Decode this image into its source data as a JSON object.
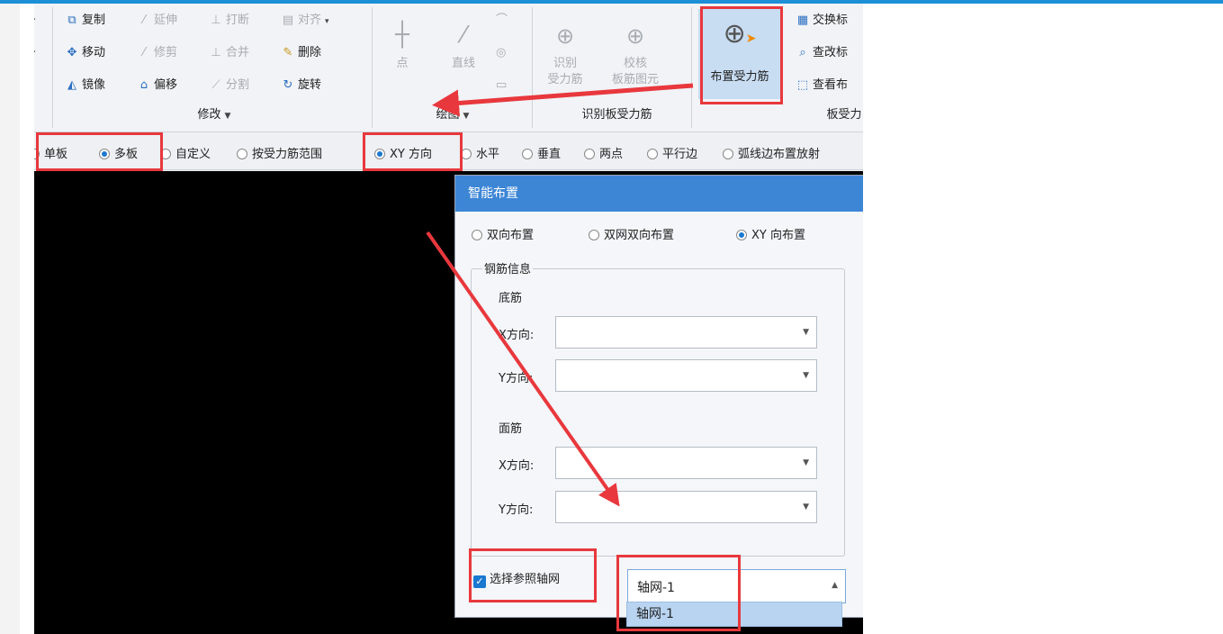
{
  "modify": {
    "tools": {
      "copy": "复制",
      "extend": "延伸",
      "break": "打断",
      "align": "对齐",
      "move": "移动",
      "trim": "修剪",
      "merge": "合并",
      "delete": "删除",
      "mirror": "镜像",
      "offset": "偏移",
      "split": "分割",
      "rotate": "旋转"
    },
    "title": "修改"
  },
  "draw": {
    "point": "点",
    "line": "直线",
    "title": "绘图"
  },
  "identify": {
    "identify_l1": "识别",
    "identify_l2": "受力筋",
    "check_l1": "校核",
    "check_l2": "板筋图元",
    "title": "识别板受力筋"
  },
  "rebar": {
    "place": "布置受力筋",
    "swap": "交换标",
    "modify": "查改标",
    "view": "查看布",
    "title": "板受力"
  },
  "options": {
    "single": "单板",
    "multi": "多板",
    "custom": "自定义",
    "by_range": "按受力筋范围",
    "xy": "XY 方向",
    "horizontal": "水平",
    "vertical": "垂直",
    "two_points": "两点",
    "parallel": "平行边",
    "arc": "弧线边布置放射"
  },
  "dialog": {
    "title": "智能布置",
    "modes": {
      "bidir": "双向布置",
      "dual_net": "双网双向布置",
      "xy": "XY 向布置"
    },
    "rebar_info": "钢筋信息",
    "bottom": "底筋",
    "top": "面筋",
    "x_dir": "X方向:",
    "y_dir": "Y方向:",
    "ref_grid": "选择参照轴网",
    "grid_value": "轴网-1",
    "grid_option": "轴网-1"
  },
  "colors": {
    "accent": "#3d86d6",
    "highlight": "#e8383d",
    "canvas": "#000000"
  }
}
